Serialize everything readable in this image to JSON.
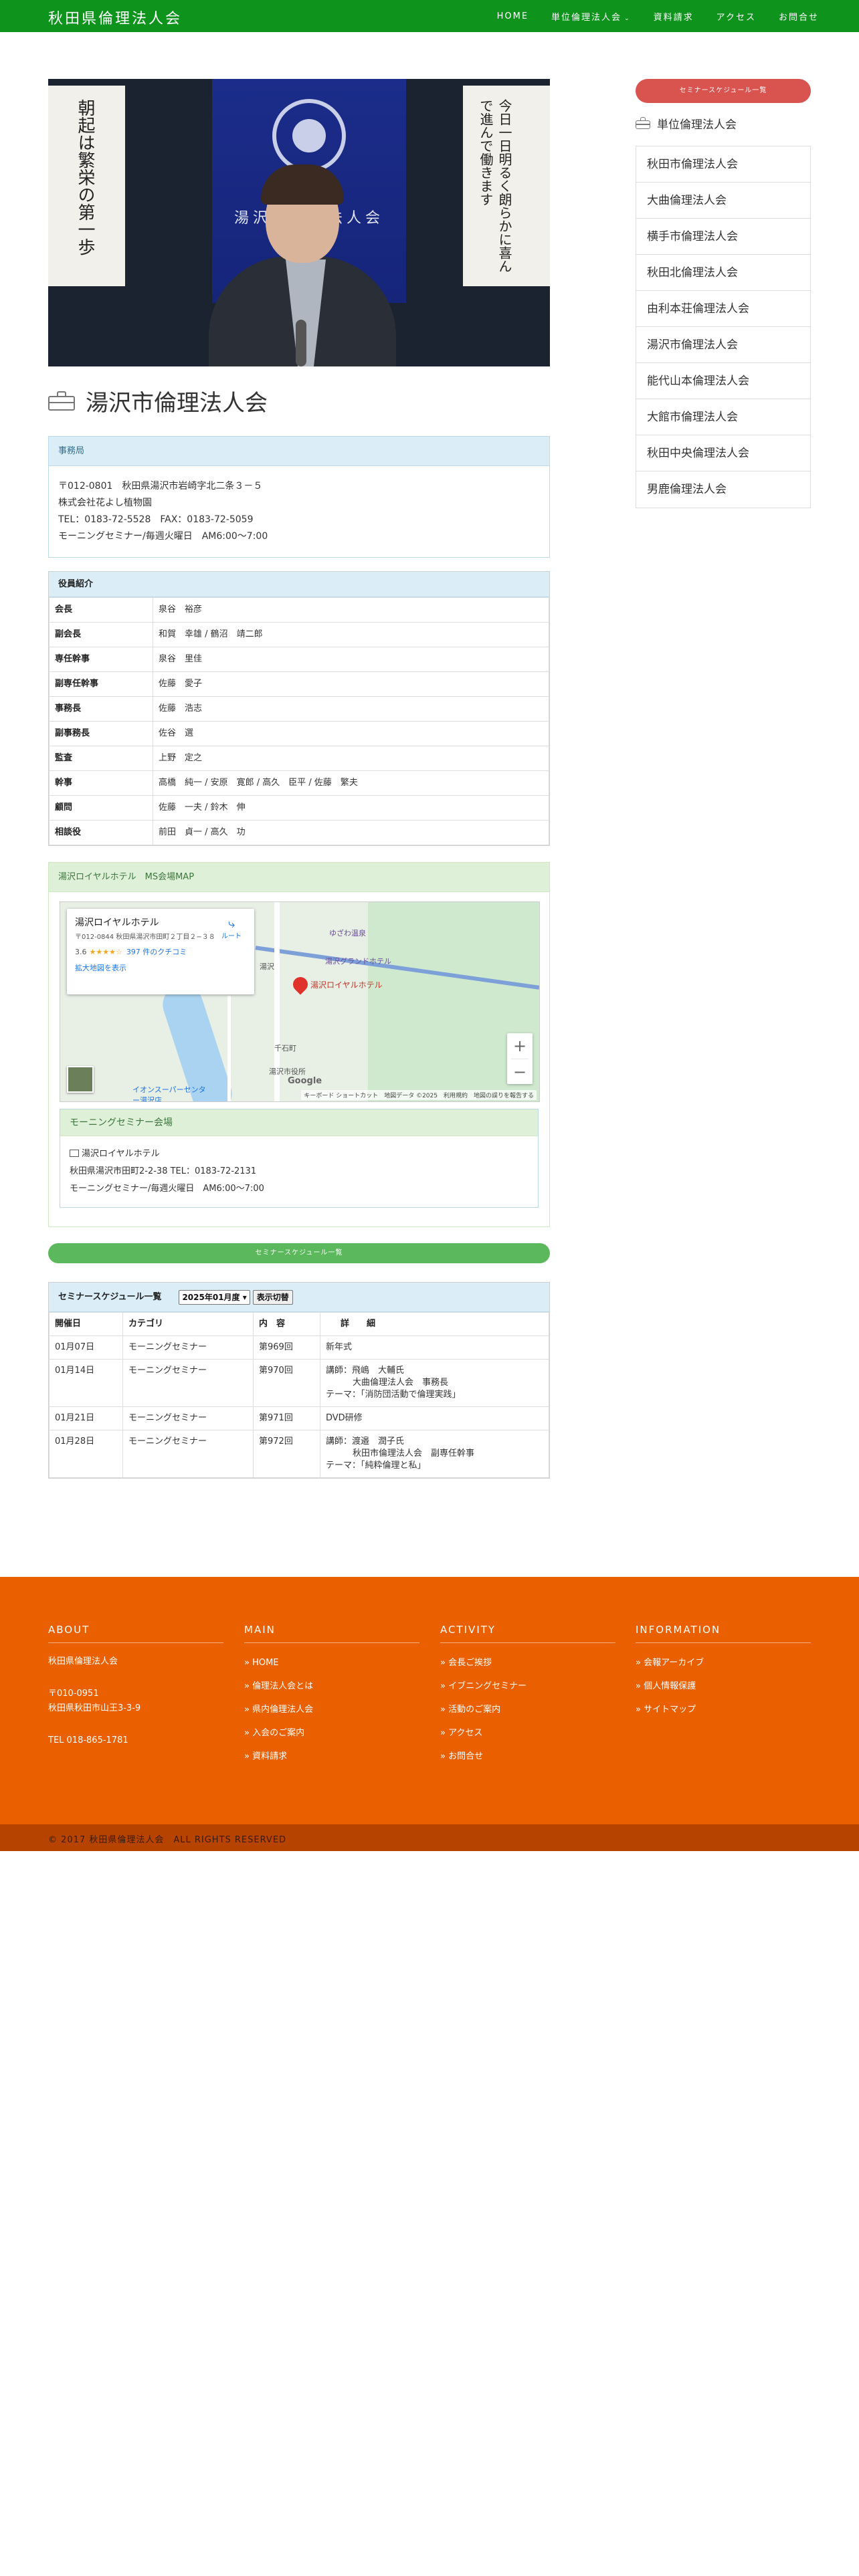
{
  "site": {
    "title": "秋田県倫理法人会"
  },
  "nav": [
    {
      "label": "HOME"
    },
    {
      "label": "単位倫理法人会"
    },
    {
      "label": "資料請求"
    },
    {
      "label": "アクセス"
    },
    {
      "label": "お問合せ"
    }
  ],
  "hero": {
    "banner_text": "湯沢市倫理法人会",
    "scroll_left": "朝起は繁栄の第一歩",
    "scroll_right": "今日一日明るく朗らかに喜んで進んで働きます"
  },
  "page_title": "湯沢市倫理法人会",
  "office": {
    "heading": "事務局",
    "lines": [
      "〒012-0801　秋田県湯沢市岩崎字北二条３－５",
      "株式会社花よし植物園",
      "TEL：0183-72-5528　FAX：0183-72-5059",
      "モーニングセミナー/毎週火曜日　AM6:00〜7:00"
    ]
  },
  "officers": {
    "heading": "役員紹介",
    "rows": [
      {
        "role": "会長",
        "names": "泉谷　裕彦"
      },
      {
        "role": "副会長",
        "names": "和賀　幸雄 / 鶴沼　靖二郎"
      },
      {
        "role": "専任幹事",
        "names": "泉谷　里佳"
      },
      {
        "role": "副専任幹事",
        "names": "佐藤　愛子"
      },
      {
        "role": "事務長",
        "names": "佐藤　浩志"
      },
      {
        "role": "副事務長",
        "names": "佐谷　選"
      },
      {
        "role": "監査",
        "names": "上野　定之"
      },
      {
        "role": "幹事",
        "names": "高橋　純一 / 安原　寛郎 / 高久　臣平 / 佐藤　繁夫"
      },
      {
        "role": "顧問",
        "names": "佐藤　一夫 / 鈴木　伸"
      },
      {
        "role": "相談役",
        "names": "前田　貞一 / 高久　功"
      }
    ]
  },
  "map_section": {
    "heading": "湯沢ロイヤルホテル　MS会場MAP",
    "info_card": {
      "title": "湯沢ロイヤルホテル",
      "address": "〒012-0844 秋田県湯沢市田町２丁目２−３８",
      "rating": "3.6",
      "stars": "★★★★☆",
      "reviews": "397 件のクチコミ",
      "larger_map": "拡大地図を表示",
      "route": "ルート"
    },
    "labels": {
      "pin": "湯沢ロイヤルホテル",
      "grand_hotel": "湯沢グランドホテル",
      "yuzawa_onsen": "ゆざわ温泉",
      "station": "湯沢",
      "aeon": "イオンスーパーセンター湯沢店",
      "city_hall": "湯沢市役所",
      "chome": "千石町"
    },
    "google_logo": "Google",
    "attribution": "キーボード ショートカット　地図データ ©2025　利用規約　地図の誤りを報告する",
    "zoom_in": "+",
    "zoom_out": "−"
  },
  "venue": {
    "heading": "モーニングセミナー会場",
    "name": "湯沢ロイヤルホテル",
    "address": "秋田県湯沢市田町2-2-38 TEL：0183-72-2131",
    "schedule": "モーニングセミナー/毎週火曜日　AM6:00〜7:00"
  },
  "seminar_button": "セミナースケジュール一覧",
  "schedule": {
    "heading": "セミナースケジュール一覧",
    "selected_month": "2025年01月度",
    "show_button": "表示切替",
    "columns": [
      "開催日",
      "カテゴリ",
      "内　容",
      "詳　　細"
    ],
    "rows": [
      {
        "date": "01月07日",
        "category": "モーニングセミナー",
        "content": "第969回",
        "details": [
          "新年式"
        ]
      },
      {
        "date": "01月14日",
        "category": "モーニングセミナー",
        "content": "第970回",
        "details": [
          "講師：飛嶋　大輔氏",
          "大曲倫理法人会　事務長",
          "テーマ：「消防団活動で倫理実践」"
        ]
      },
      {
        "date": "01月21日",
        "category": "モーニングセミナー",
        "content": "第971回",
        "details": [
          "DVD研修"
        ]
      },
      {
        "date": "01月28日",
        "category": "モーニングセミナー",
        "content": "第972回",
        "details": [
          "講師：渡邉　潤子氏",
          "秋田市倫理法人会　副専任幹事",
          "テーマ：「純粋倫理と私」"
        ]
      }
    ]
  },
  "sidebar": {
    "button": "セミナースケジュール一覧",
    "heading": "単位倫理法人会",
    "items": [
      "秋田市倫理法人会",
      "大曲倫理法人会",
      "横手市倫理法人会",
      "秋田北倫理法人会",
      "由利本荘倫理法人会",
      "湯沢市倫理法人会",
      "能代山本倫理法人会",
      "大館市倫理法人会",
      "秋田中央倫理法人会",
      "男鹿倫理法人会"
    ]
  },
  "footer": {
    "about": {
      "heading": "ABOUT",
      "name": "秋田県倫理法人会",
      "zip": "〒010-0951",
      "address": "秋田県秋田市山王3-3-9",
      "tel": "TEL 018-865-1781"
    },
    "main": {
      "heading": "MAIN",
      "links": [
        "» HOME",
        "» 倫理法人会とは",
        "» 県内倫理法人会",
        "» 入会のご案内",
        "» 資料請求"
      ]
    },
    "activity": {
      "heading": "ACTIVITY",
      "links": [
        "» 会長ご挨拶",
        "» イブニングセミナー",
        "» 活動のご案内",
        "» アクセス",
        "» お問合せ"
      ]
    },
    "information": {
      "heading": "INFORMATION",
      "links": [
        "» 会報アーカイブ",
        "» 個人情報保護",
        "» サイトマップ"
      ]
    },
    "copyright": "© 2017 秋田県倫理法人会　ALL RIGHTS RESERVED"
  },
  "colors": {
    "header": "#0e941c",
    "footer": "#ea5f00",
    "copyright_bar": "#b74300",
    "red_button": "#d9534f",
    "green_button": "#5cb85c",
    "panel_info": "#dbeef8",
    "panel_success": "#dff0d8"
  }
}
